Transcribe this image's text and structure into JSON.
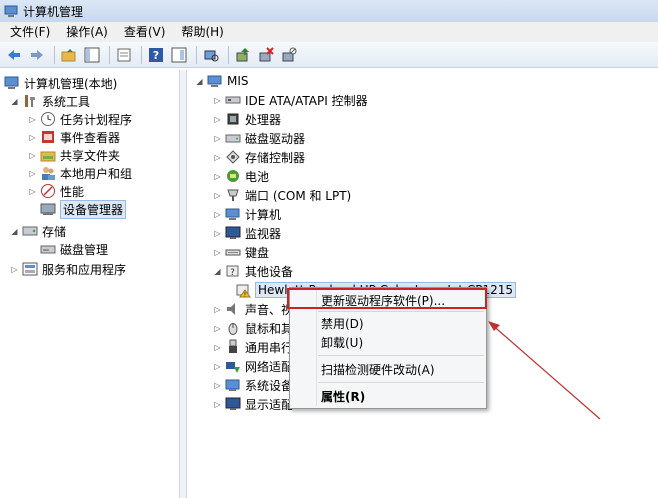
{
  "window": {
    "title": "计算机管理"
  },
  "menu": [
    "文件(F)",
    "操作(A)",
    "查看(V)",
    "帮助(H)"
  ],
  "left_tree": {
    "root": "计算机管理(本地)",
    "system_tools": "系统工具",
    "task_scheduler": "任务计划程序",
    "event_viewer": "事件查看器",
    "shared_folders": "共享文件夹",
    "local_users": "本地用户和组",
    "performance": "性能",
    "device_manager": "设备管理器",
    "storage": "存储",
    "disk_management": "磁盘管理",
    "services": "服务和应用程序"
  },
  "device_tree": {
    "root": "MIS",
    "ide": "IDE ATA/ATAPI 控制器",
    "processor": "处理器",
    "disk": "磁盘驱动器",
    "storage_ctrl": "存储控制器",
    "battery": "电池",
    "ports": "端口 (COM 和 LPT)",
    "computer": "计算机",
    "monitor": "监视器",
    "keyboard": "键盘",
    "other": "其他设备",
    "printer": "Hewlett-Packard HP Color LaserJet CP1215",
    "sound": "声音、视",
    "mouse": "鼠标和其",
    "serial": "通用串行",
    "network": "网络适配",
    "sysdev": "系统设备",
    "display": "显示适配"
  },
  "context_menu": {
    "update_driver": "更新驱动程序软件(P)...",
    "disable": "禁用(D)",
    "uninstall": "卸载(U)",
    "scan": "扫描检测硬件改动(A)",
    "properties": "属性(R)"
  },
  "colors": {
    "highlight": "#cc2222",
    "arrow": "#c03030",
    "folder": "#e8b94a"
  }
}
